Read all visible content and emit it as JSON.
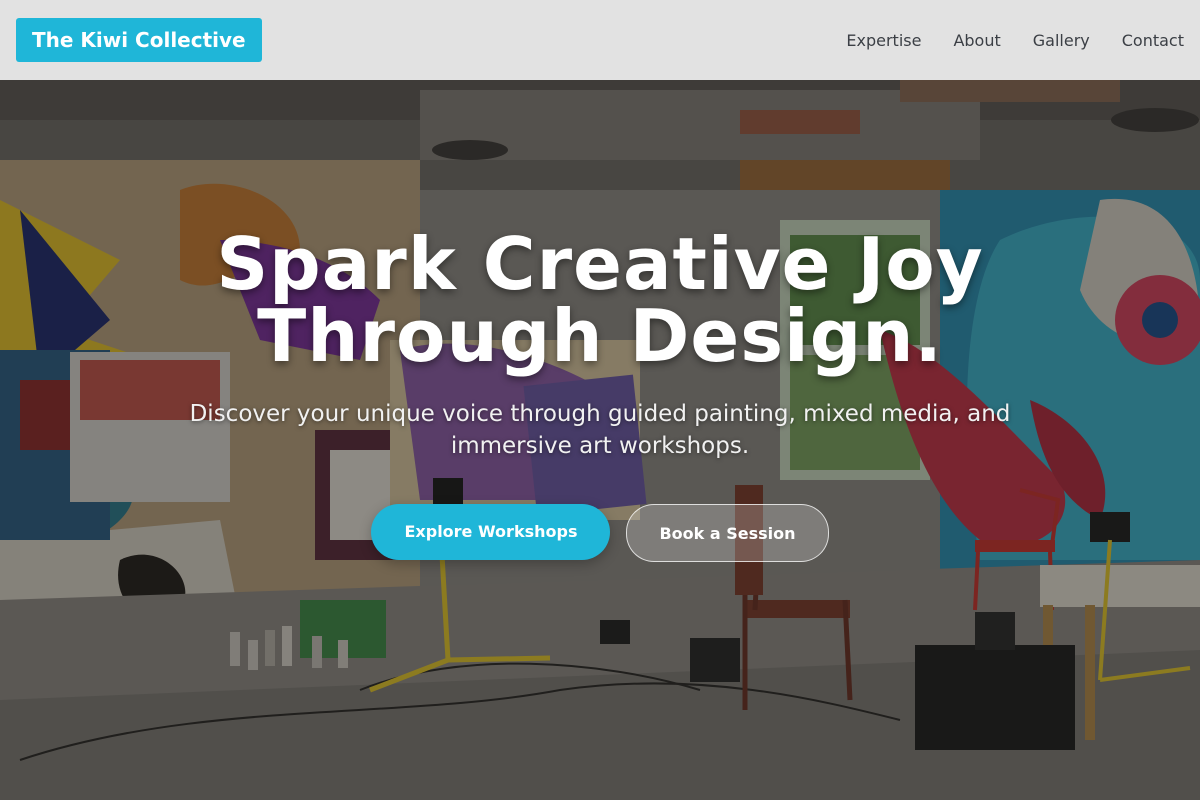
{
  "header": {
    "brand": "The Kiwi Collective",
    "nav": [
      "Expertise",
      "About",
      "Gallery",
      "Contact"
    ]
  },
  "hero": {
    "headline_line1": "Spark Creative Joy",
    "headline_line2": "Through Design.",
    "subtitle": "Discover your unique voice through guided painting, mixed media, and immersive art workshops.",
    "primary_cta": "Explore Workshops",
    "secondary_cta": "Book a Session"
  },
  "colors": {
    "accent": "#1fb6d8",
    "header_bg": "#f0f0f0",
    "nav_text": "#3b3f45",
    "headline_text": "#ffffff"
  }
}
